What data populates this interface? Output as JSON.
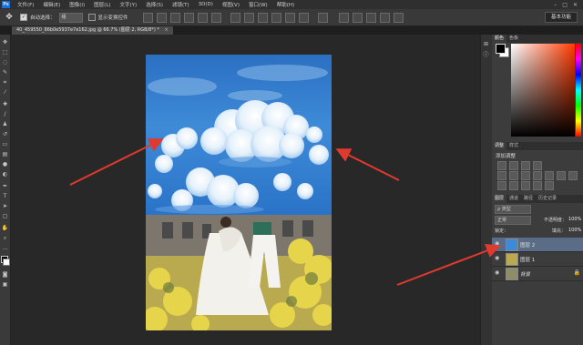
{
  "menubar": {
    "logo": "Ps",
    "items": [
      "文件(F)",
      "编辑(E)",
      "图像(I)",
      "图层(L)",
      "文字(Y)",
      "选择(S)",
      "滤镜(T)",
      "3D(D)",
      "视图(V)",
      "窗口(W)",
      "帮助(H)"
    ],
    "window_controls": [
      "–",
      "□",
      "✕"
    ]
  },
  "optionsbar": {
    "auto_select_label": "自动选择：",
    "auto_select_value": "组",
    "show_transform_label": "显示变换控件",
    "workspace": "基本功能"
  },
  "document": {
    "tab_title": "40_459550_86b0e5937e7e162.jpg @ 66.7% (图层 2, RGB/8*) *",
    "close": "×"
  },
  "panels": {
    "color_tabs": [
      "颜色",
      "色板"
    ],
    "adjust_tabs": [
      "调整",
      "样式"
    ],
    "adjust_title": "添加调整",
    "layers_tabs": [
      "图层",
      "通道",
      "路径",
      "历史记录"
    ],
    "kind_label": "ρ 类型",
    "blend_mode": "正常",
    "opacity_label": "不透明度：",
    "opacity_value": "100%",
    "lock_label": "锁定：",
    "fill_label": "填充：",
    "fill_value": "100%",
    "layers": [
      {
        "name": "图层 2",
        "selected": true
      },
      {
        "name": "图层 1",
        "selected": false
      },
      {
        "name": "背景",
        "selected": false,
        "locked": true
      }
    ]
  },
  "colors": {
    "accent_selected_layer": "#5a6c86",
    "arrow": "#e03a2f",
    "foreground": "#000000",
    "background": "#ffffff"
  }
}
